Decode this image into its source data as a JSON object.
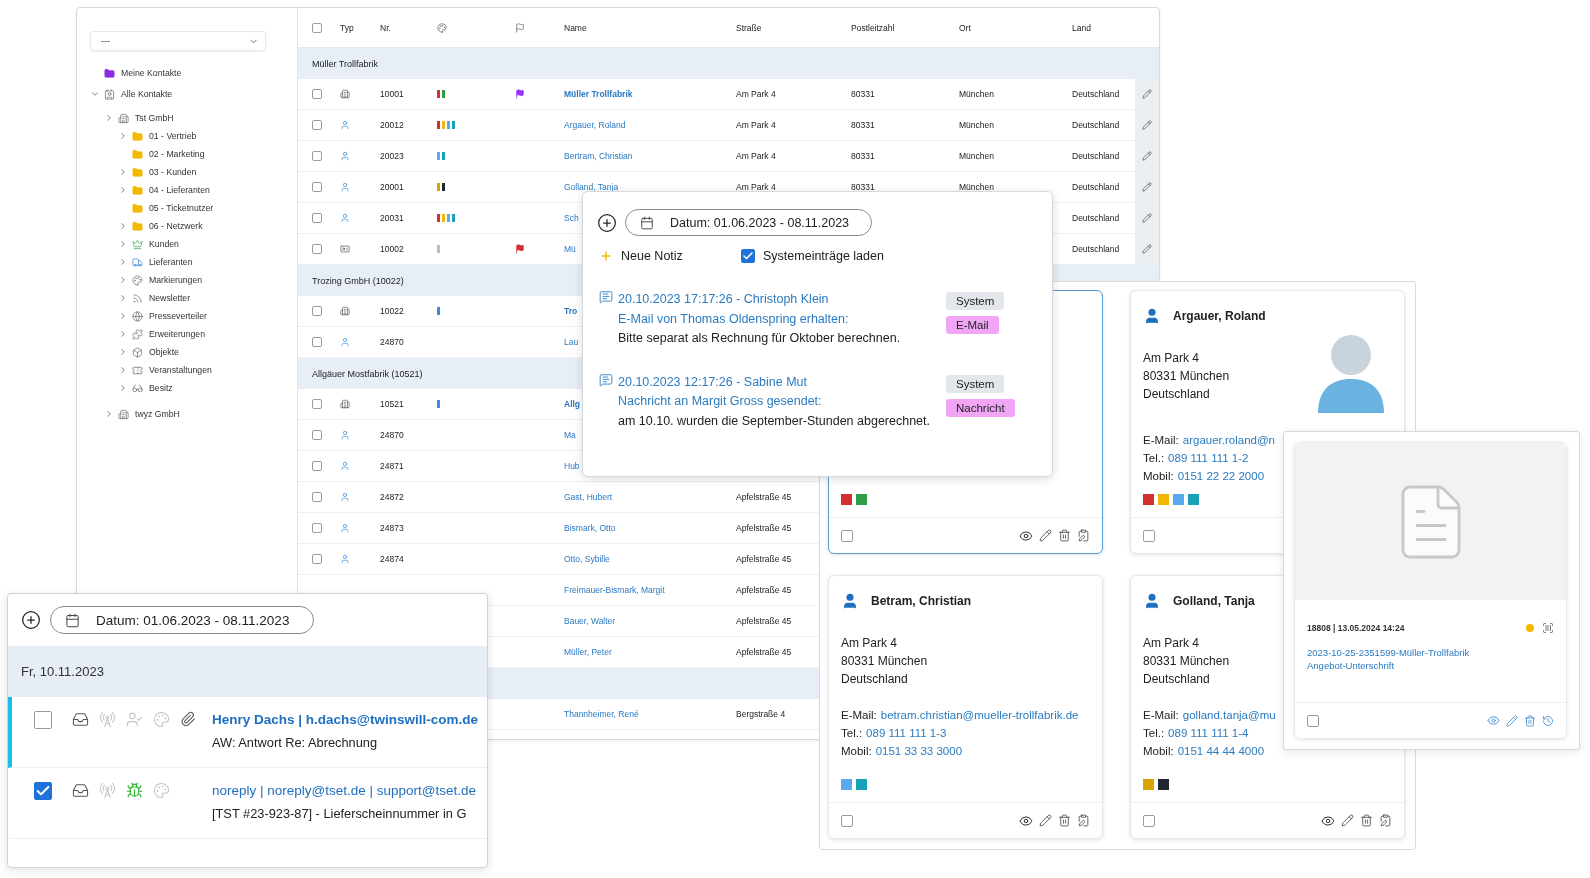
{
  "sidebar": {
    "filter": {
      "value": "---"
    },
    "tree": [
      {
        "label": "Meine Kontakte",
        "kind": "folder",
        "color": "#8a2be2"
      },
      {
        "label": "Alle Kontakte",
        "kind": "contacts",
        "expanded": true,
        "children": [
          {
            "label": "Tst GmbH",
            "kind": "company",
            "expanded": false,
            "children": [
              {
                "label": "01 - Vertrieb",
                "kind": "folder",
                "color": "#f5b800",
                "expanded": false
              },
              {
                "label": "02 - Marketing",
                "kind": "folder",
                "color": "#f5b800"
              },
              {
                "label": "03 - Kunden",
                "kind": "folder",
                "color": "#f5b800",
                "expanded": false
              },
              {
                "label": "04 - Lieferanten",
                "kind": "folder",
                "color": "#f5b800",
                "expanded": false
              },
              {
                "label": "05 - Ticketnutzer",
                "kind": "folder",
                "color": "#f5b800"
              },
              {
                "label": "06 - Netzwerk",
                "kind": "folder",
                "color": "#f5b800",
                "expanded": false
              },
              {
                "label": "Kunden",
                "kind": "crown",
                "expanded": false
              },
              {
                "label": "Lieferanten",
                "kind": "truck",
                "expanded": false
              },
              {
                "label": "Markierungen",
                "kind": "palette",
                "expanded": false
              },
              {
                "label": "Newsletter",
                "kind": "rss",
                "expanded": false
              },
              {
                "label": "Presseverteiler",
                "kind": "globe",
                "expanded": false
              },
              {
                "label": "Erweiterungen",
                "kind": "extension",
                "expanded": false
              },
              {
                "label": "Objekte",
                "kind": "cube",
                "expanded": false
              },
              {
                "label": "Veranstaltungen",
                "kind": "event",
                "expanded": false
              },
              {
                "label": "Besitz",
                "kind": "glasses",
                "expanded": false
              }
            ]
          },
          {
            "label": "twyz GmbH",
            "kind": "company",
            "expanded": false
          }
        ]
      }
    ]
  },
  "table": {
    "columns": [
      {
        "kind": "select",
        "checked": false
      },
      {
        "kind": "text",
        "label": "Typ"
      },
      {
        "kind": "text",
        "label": "Nr."
      },
      {
        "kind": "color"
      },
      {
        "kind": "flag"
      },
      {
        "kind": "text",
        "label": "Name"
      },
      {
        "kind": "text",
        "label": "Straße"
      },
      {
        "kind": "text",
        "label": "Postleitzahl"
      },
      {
        "kind": "text",
        "label": "Ort"
      },
      {
        "kind": "text",
        "label": "Land"
      }
    ],
    "groups": [
      {
        "label": "Müller Trollfabrik",
        "rows": [
          {
            "checked": false,
            "kind": "company",
            "nr": "10001",
            "tags": [
              {
                "color": "#d32f2f"
              },
              {
                "color": "#2e9e44"
              }
            ],
            "flag": {
              "color": "#9b30ff"
            },
            "name": "Müller Trollfabrik",
            "street": "Am Park 4",
            "zip": "80331",
            "city": "München",
            "country": "Deutschland"
          },
          {
            "checked": false,
            "kind": "person",
            "nr": "20012",
            "tags": [
              {
                "color": "#d32f2f"
              },
              {
                "color": "#f2b705"
              },
              {
                "color": "#5aa9f0"
              },
              {
                "color": "#17a2b8"
              }
            ],
            "name": "Argauer, Roland",
            "street": "Am Park 4",
            "zip": "80331",
            "city": "München",
            "country": "Deutschland"
          },
          {
            "checked": false,
            "kind": "person",
            "nr": "20023",
            "tags": [
              {
                "color": "#5aa9f0"
              },
              {
                "color": "#17a2b8"
              }
            ],
            "name": "Bertram, Christian",
            "street": "Am Park 4",
            "zip": "80331",
            "city": "München",
            "country": "Deutschland"
          },
          {
            "checked": false,
            "kind": "person",
            "nr": "20001",
            "tags": [
              {
                "color": "#d9a300"
              },
              {
                "color": "#222831"
              }
            ],
            "name": "Golland, Tanja",
            "street": "Am Park 4",
            "zip": "80331",
            "city": "München",
            "country": "Deutschland"
          },
          {
            "checked": false,
            "kind": "person",
            "nr": "20031",
            "tags": [
              {
                "color": "#d32f2f"
              },
              {
                "color": "#f2b705"
              },
              {
                "color": "#5aa9f0"
              },
              {
                "color": "#17a2b8"
              }
            ],
            "name": "Sch",
            "country": "Deutschland"
          },
          {
            "checked": false,
            "kind": "card",
            "nr": "10002",
            "tags": [
              {
                "color": "#bdbdbd"
              }
            ],
            "flag": {
              "color": "#d32f2f"
            },
            "name": "Mü",
            "country": "Deutschland"
          }
        ]
      },
      {
        "label": "Trozing GmbH (10022)",
        "rows": [
          {
            "checked": false,
            "kind": "company",
            "nr": "10022",
            "tags": [
              {
                "color": "#3b8be0"
              }
            ],
            "name": "Tro"
          },
          {
            "checked": false,
            "kind": "person",
            "nr": "24870",
            "name": "Lau"
          }
        ]
      },
      {
        "label": "Allgäuer Mostfabrik (10521)",
        "rows": [
          {
            "checked": false,
            "kind": "company",
            "nr": "10521",
            "tags": [
              {
                "color": "#3b8be0"
              }
            ],
            "name": "Allg"
          },
          {
            "checked": false,
            "kind": "person",
            "nr": "24870",
            "name": "Ma"
          },
          {
            "checked": false,
            "kind": "person",
            "nr": "24871",
            "name": "Hub"
          },
          {
            "checked": false,
            "kind": "person",
            "nr": "24872",
            "name": "Gast, Hubert",
            "street": "Apfelstraße 45"
          },
          {
            "checked": false,
            "kind": "person",
            "nr": "24873",
            "name": "Bismark, Otto",
            "street": "Apfelstraße 45"
          },
          {
            "checked": false,
            "kind": "person",
            "nr": "24874",
            "name": "Otto, Sybille",
            "street": "Apfelstraße 45"
          },
          {
            "name": "Freimauer-Bismark, Margit",
            "street": "Apfelstraße 45"
          },
          {
            "name": "Bauer, Walter",
            "street": "Apfelstraße 45"
          },
          {
            "name": "Müller, Peter",
            "street": "Apfelstraße 45"
          }
        ]
      },
      {
        "rows": [
          {
            "name": "Thannheimer, René",
            "street": "Bergstraße 4"
          }
        ]
      }
    ]
  },
  "cards": [
    {
      "selected": true,
      "checked": false,
      "colors": [
        {
          "color": "#d32f2f"
        },
        {
          "color": "#2e9e44"
        }
      ]
    },
    {
      "selected": false,
      "checked": false,
      "name": "Argauer, Roland",
      "avatar": true,
      "address": [
        "Am Park 4",
        "80331 München",
        "Deutschland"
      ],
      "contacts": [
        {
          "label": "E-Mail:",
          "value": "argauer.roland@n"
        },
        {
          "label": "Tel.:",
          "value": "089 111 111 1-2"
        },
        {
          "label": "Mobil:",
          "value": "0151 22 22 2000"
        }
      ],
      "colors": [
        {
          "color": "#d32f2f"
        },
        {
          "color": "#f2b705"
        },
        {
          "color": "#5aa9f0"
        },
        {
          "color": "#17a2b8"
        }
      ]
    },
    {
      "selected": false,
      "checked": false,
      "name": "Betram, Christian",
      "address": [
        "Am Park 4",
        "80331 München",
        "Deutschland"
      ],
      "contacts": [
        {
          "label": "E-Mail:",
          "value": "betram.christian@mueller-trollfabrik.de"
        },
        {
          "label": "Tel.:",
          "value": "089 111 111 1-3"
        },
        {
          "label": "Mobil:",
          "value": "0151 33 33 3000"
        }
      ],
      "colors": [
        {
          "color": "#5aa9f0"
        },
        {
          "color": "#17a2b8"
        }
      ]
    },
    {
      "selected": false,
      "checked": false,
      "name": "Golland, Tanja",
      "address": [
        "Am Park 4",
        "80331 München",
        "Deutschland"
      ],
      "contacts": [
        {
          "label": "E-Mail:",
          "value": "golland.tanja@mu"
        },
        {
          "label": "Tel.:",
          "value": "089 111 111 1-4"
        },
        {
          "label": "Mobil:",
          "value": "0151 44 44 4000"
        }
      ],
      "colors": [
        {
          "color": "#d9a300"
        },
        {
          "color": "#222831"
        }
      ]
    }
  ],
  "notes_popup": {
    "date_range": "Datum: 01.06.2023 - 08.11.2023",
    "new_note": "Neue Notiz",
    "system_entries": {
      "label": "Systemeinträge laden",
      "checked": true
    },
    "notes": [
      {
        "title": "20.10.2023 17:17:26 - Christoph Klein",
        "subtitle": "E-Mail von Thomas Oldenspring erhalten:",
        "body": "Bitte separat als Rechnung für Oktober berechnen.",
        "tags": [
          {
            "label": "System",
            "color": "#e3e6ea"
          },
          {
            "label": "E-Mail",
            "color": "#f0a6f5"
          }
        ]
      },
      {
        "title": "20.10.2023 12:17:26 - Sabine Mut",
        "subtitle": "Nachricht an Margit Gross gesendet:",
        "body": "am 10.10. wurden die September-Stunden abgerechnet.",
        "tags": [
          {
            "label": "System",
            "color": "#e3e6ea"
          },
          {
            "label": "Nachricht",
            "color": "#f0a6f5"
          }
        ]
      }
    ]
  },
  "file_card": {
    "meta": "18808 | 13.05.2024 14:24",
    "status": {
      "color": "#f5b800"
    },
    "link": "2023-10-25-2351599-Müller-Trollfabrik Angebot-Unterschrift",
    "checked": false
  },
  "mail_popup": {
    "date_range": "Datum: 01.06.2023 - 08.11.2023",
    "day": "Fr, 10.11.2023",
    "messages": [
      {
        "kind": "mail",
        "unread": true,
        "checked": false,
        "attachment": true,
        "from": "Henry Dachs | h.dachs@twinswill-com.de",
        "subject": "AW: Antwort Re: Abrechnung"
      },
      {
        "kind": "ticket",
        "unread": false,
        "checked": true,
        "attachment": false,
        "from": "noreply | noreply@tset.de | support@tset.de",
        "subject": "[TST #23-923-87] - Lieferscheinnummer in G"
      }
    ]
  }
}
